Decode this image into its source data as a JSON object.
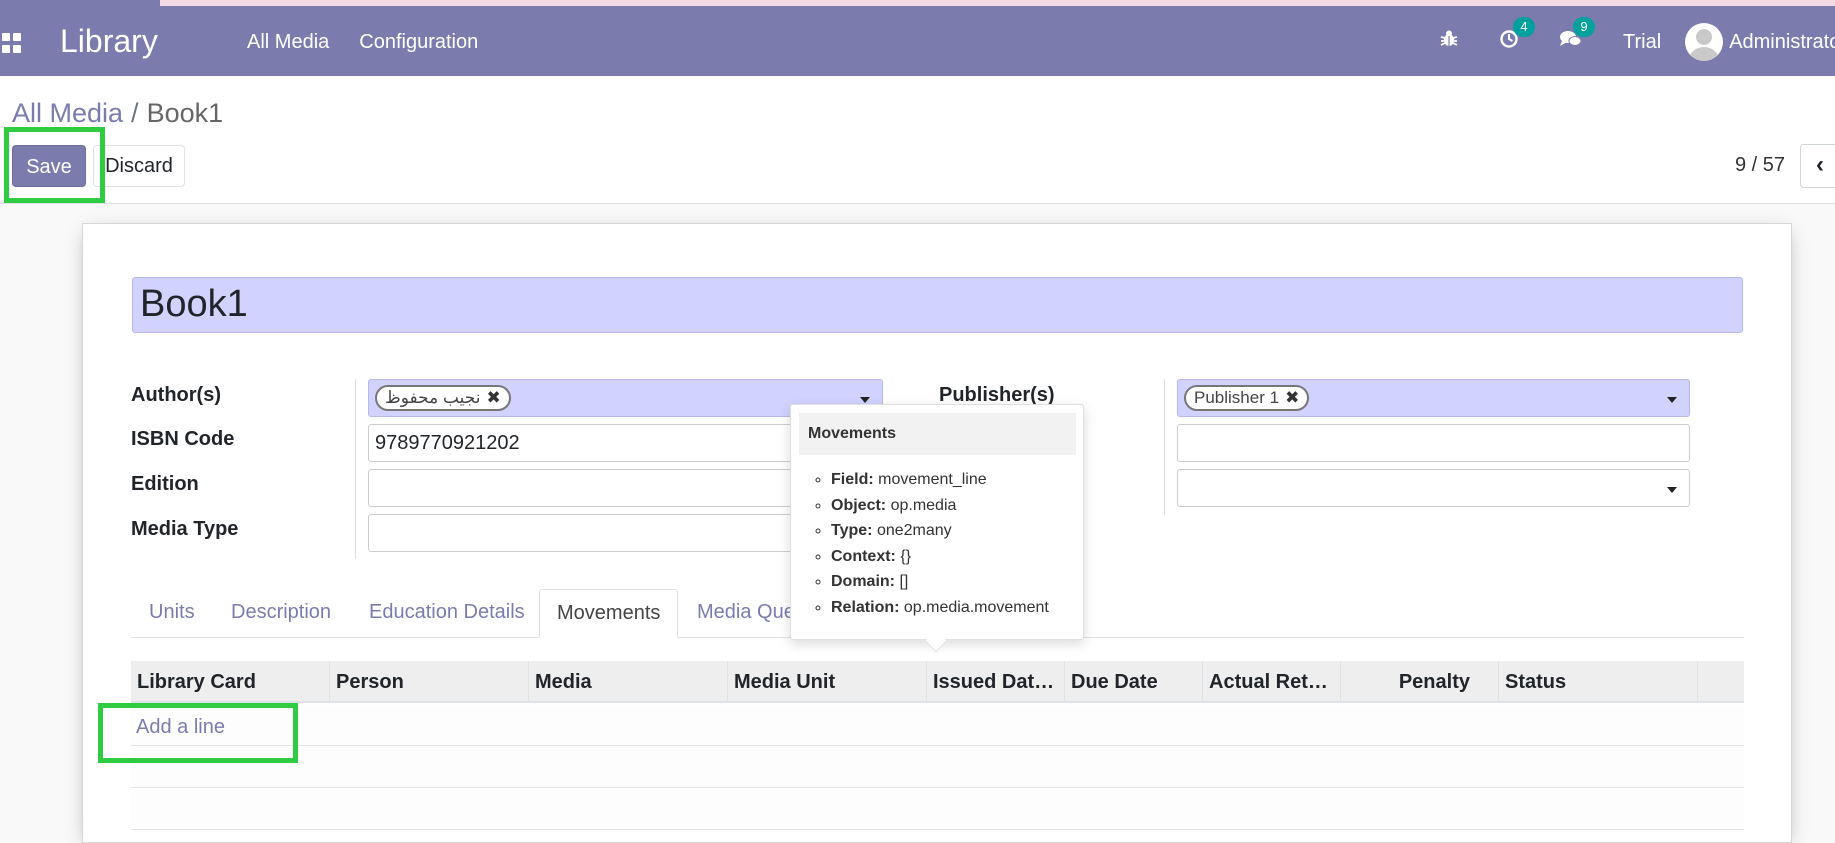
{
  "navbar": {
    "brand": "Library",
    "menu": [
      "All Media",
      "Configuration"
    ],
    "activity_count": "4",
    "messages_count": "9",
    "trial_label": "Trial",
    "user_name": "Administrator"
  },
  "breadcrumb": {
    "parent": "All Media",
    "separator": "/",
    "current": "Book1"
  },
  "buttons": {
    "save": "Save",
    "discard": "Discard"
  },
  "pager": {
    "value": "9 / 57",
    "prev_icon": "‹"
  },
  "form": {
    "name": "Book1",
    "labels": {
      "authors": "Author(s)",
      "isbn": "ISBN Code",
      "edition": "Edition",
      "media_type": "Media Type",
      "publishers": "Publisher(s)"
    },
    "authors": [
      "نجيب محفوظ"
    ],
    "isbn": "9789770921202",
    "edition": "",
    "media_type": "",
    "publishers": [
      "Publisher 1"
    ],
    "tag_remove_icon": "✖"
  },
  "tabs": [
    "Units",
    "Description",
    "Education Details",
    "Movements",
    "Media Que"
  ],
  "active_tab": "Movements",
  "table": {
    "columns": [
      "Library Card",
      "Person",
      "Media",
      "Media Unit",
      "Issued Dat…",
      "Due Date",
      "Actual Ret…",
      "Penalty",
      "Status"
    ],
    "add_line": "Add a line"
  },
  "tooltip": {
    "title": "Movements",
    "items": [
      {
        "key": "Field:",
        "value": "movement_line"
      },
      {
        "key": "Object:",
        "value": "op.media"
      },
      {
        "key": "Type:",
        "value": "one2many"
      },
      {
        "key": "Context:",
        "value": "{}"
      },
      {
        "key": "Domain:",
        "value": "[]"
      },
      {
        "key": "Relation:",
        "value": "op.media.movement"
      }
    ]
  },
  "colors": {
    "brand": "#7c7bad",
    "required_field": "#d2d2ff",
    "badge": "#00a09d",
    "highlight": "#2ecc40"
  }
}
